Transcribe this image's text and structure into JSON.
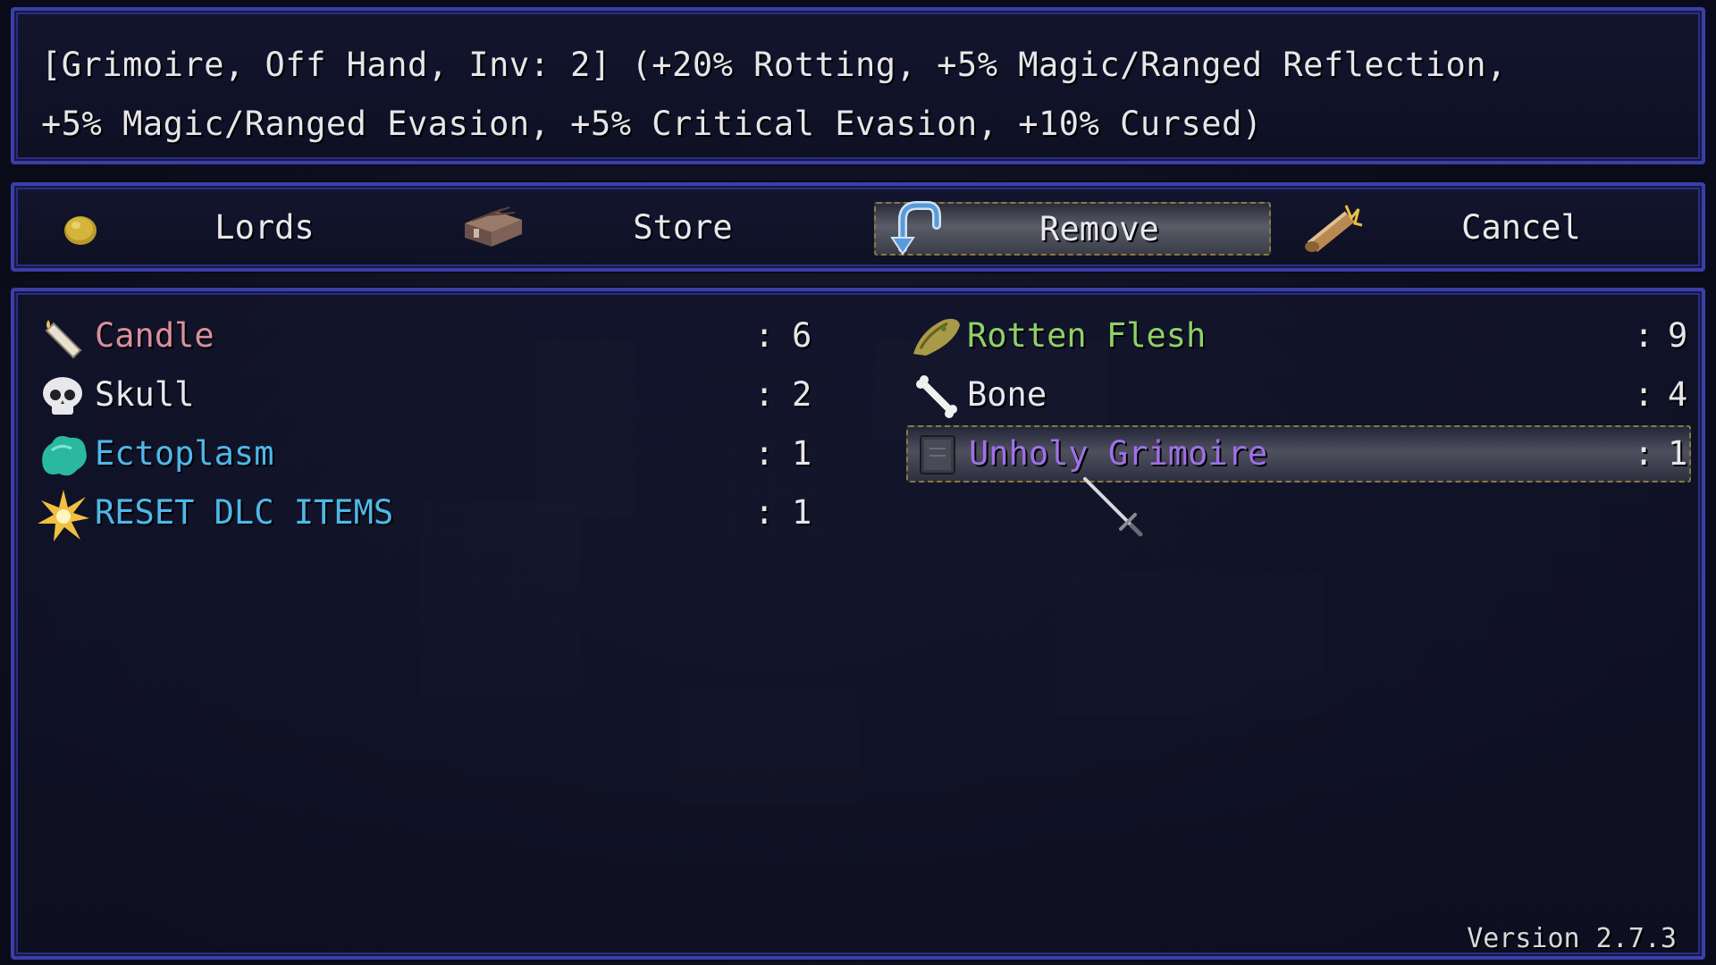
{
  "help": {
    "line1": "[Grimoire, Off Hand, Inv: 2] (+20% Rotting, +5% Magic/Ranged Reflection,",
    "line2": "+5% Magic/Ranged Evasion, +5% Critical Evasion, +10% Cursed)"
  },
  "commands": [
    {
      "label": "Lords",
      "icon": "gold-coin-icon"
    },
    {
      "label": "Store",
      "icon": "chest-icon"
    },
    {
      "label": "Remove",
      "icon": "return-arrow-icon",
      "selected": true
    },
    {
      "label": "Cancel",
      "icon": "scroll-icon"
    }
  ],
  "items": [
    {
      "name": "Candle",
      "qty": "6",
      "color": "#d98f9f",
      "icon": "candle-icon"
    },
    {
      "name": "Rotten Flesh",
      "qty": "9",
      "color": "#8fd06a",
      "icon": "rotten-flesh-icon"
    },
    {
      "name": "Skull",
      "qty": "2",
      "color": "#e8e8ee",
      "icon": "skull-icon"
    },
    {
      "name": "Bone",
      "qty": "4",
      "color": "#e8e8ee",
      "icon": "bone-icon"
    },
    {
      "name": "Ectoplasm",
      "qty": "1",
      "color": "#4fb8e8",
      "icon": "ectoplasm-icon"
    },
    {
      "name": "Unholy Grimoire",
      "qty": "1",
      "color": "#a070e8",
      "icon": "grimoire-icon",
      "selected": true
    },
    {
      "name": "RESET DLC ITEMS",
      "qty": "1",
      "color": "#4fb8e8",
      "icon": "burst-icon"
    }
  ],
  "separator": ":",
  "version": "Version 2.7.3",
  "colors": {
    "frame": "#3a3fa8",
    "selection_border": "#8a7a3a",
    "text": "#e6e6ea"
  }
}
